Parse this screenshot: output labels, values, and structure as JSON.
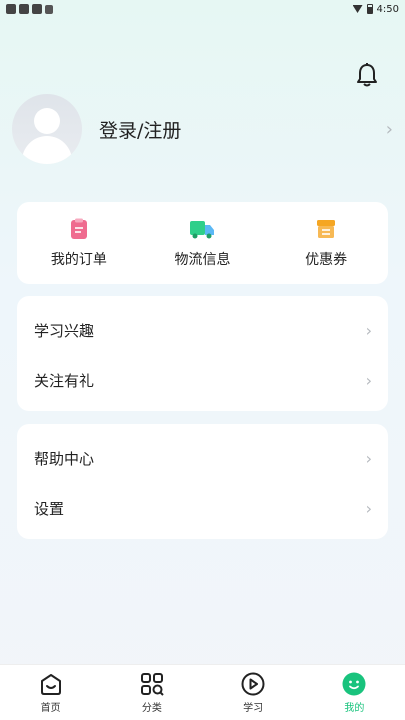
{
  "status": {
    "time": "4:50"
  },
  "profile": {
    "login_label": "登录/注册"
  },
  "quick": [
    {
      "label": "我的订单",
      "icon": "order-icon",
      "color": "#ef6b8f"
    },
    {
      "label": "物流信息",
      "icon": "truck-icon",
      "color": "#2fcf8a"
    },
    {
      "label": "优惠券",
      "icon": "coupon-icon",
      "color": "#f5a623"
    }
  ],
  "list1": [
    {
      "label": "学习兴趣"
    },
    {
      "label": "关注有礼"
    }
  ],
  "list2": [
    {
      "label": "帮助中心"
    },
    {
      "label": "设置"
    }
  ],
  "tabs": [
    {
      "label": "首页",
      "icon": "home-icon"
    },
    {
      "label": "分类",
      "icon": "category-icon"
    },
    {
      "label": "学习",
      "icon": "play-icon"
    },
    {
      "label": "我的",
      "icon": "profile-face-icon",
      "active": true
    }
  ],
  "colors": {
    "accent": "#19c37d"
  }
}
